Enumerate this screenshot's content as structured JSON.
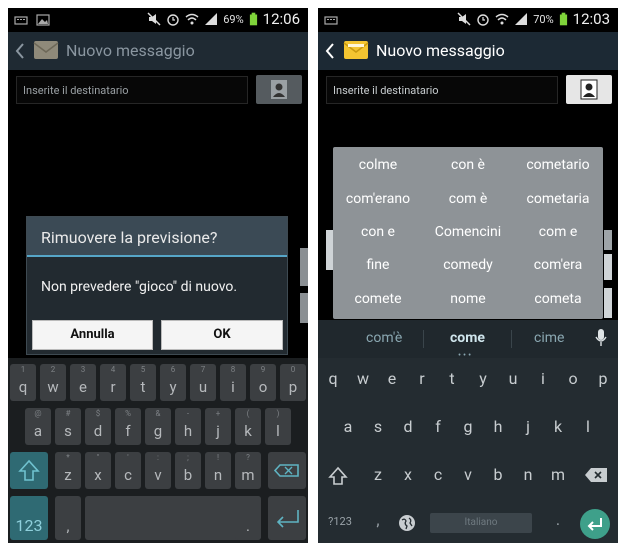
{
  "left_screen": {
    "status": {
      "battery": "69%",
      "time": "12:06"
    },
    "app_title": "Nuovo messaggio",
    "recipient_placeholder": "Inserite il destinatario",
    "dialog": {
      "title": "Rimuovere la previsione?",
      "message": "Non prevedere \"gioco\" di nuovo.",
      "cancel": "Annulla",
      "ok": "OK"
    },
    "keyboard": {
      "row1": [
        {
          "k": "q",
          "a": "1"
        },
        {
          "k": "w",
          "a": "2"
        },
        {
          "k": "e",
          "a": "3"
        },
        {
          "k": "r",
          "a": "4"
        },
        {
          "k": "t",
          "a": "5"
        },
        {
          "k": "y",
          "a": "6"
        },
        {
          "k": "u",
          "a": "7"
        },
        {
          "k": "i",
          "a": "8"
        },
        {
          "k": "o",
          "a": "9"
        },
        {
          "k": "p",
          "a": "0"
        }
      ],
      "row2": [
        {
          "k": "a",
          "a": "@"
        },
        {
          "k": "s",
          "a": "#"
        },
        {
          "k": "d",
          "a": "$"
        },
        {
          "k": "f",
          "a": "%"
        },
        {
          "k": "g",
          "a": "&"
        },
        {
          "k": "h",
          "a": "-"
        },
        {
          "k": "j",
          "a": "+"
        },
        {
          "k": "k",
          "a": "("
        },
        {
          "k": "l",
          "a": ")"
        }
      ],
      "row3": [
        {
          "k": "z",
          "a": "*"
        },
        {
          "k": "x",
          "a": "\""
        },
        {
          "k": "c",
          "a": "'"
        },
        {
          "k": "v",
          "a": ":"
        },
        {
          "k": "b",
          "a": ";"
        },
        {
          "k": "n",
          "a": "!"
        },
        {
          "k": "m",
          "a": "?"
        }
      ],
      "sym_label": "123",
      "comma": ",",
      "period": "."
    }
  },
  "right_screen": {
    "status": {
      "battery": "70%",
      "time": "12:03"
    },
    "app_title": "Nuovo messaggio",
    "recipient_placeholder": "Inserite il destinatario",
    "popup_words": [
      [
        "colme",
        "con è",
        "cometario"
      ],
      [
        "com'erano",
        "com è",
        "cometaria"
      ],
      [
        "con e",
        "Comencini",
        "com e"
      ],
      [
        "fine",
        "comedy",
        "com'era"
      ],
      [
        "comete",
        "nome",
        "cometa"
      ]
    ],
    "suggestions": [
      "com'è",
      "come",
      "cime"
    ],
    "keyboard": {
      "row1": [
        "q",
        "w",
        "e",
        "r",
        "t",
        "y",
        "u",
        "i",
        "o",
        "p"
      ],
      "row2": [
        "a",
        "s",
        "d",
        "f",
        "g",
        "h",
        "j",
        "k",
        "l"
      ],
      "row3": [
        "z",
        "x",
        "c",
        "v",
        "b",
        "n",
        "m"
      ],
      "sym_label": "?123",
      "space_label": "Italiano",
      "comma": ",",
      "period": "."
    }
  },
  "colors": {
    "accent": "#56a6c8",
    "popup": "#8e9397",
    "enter_button": "#3ea08a"
  }
}
